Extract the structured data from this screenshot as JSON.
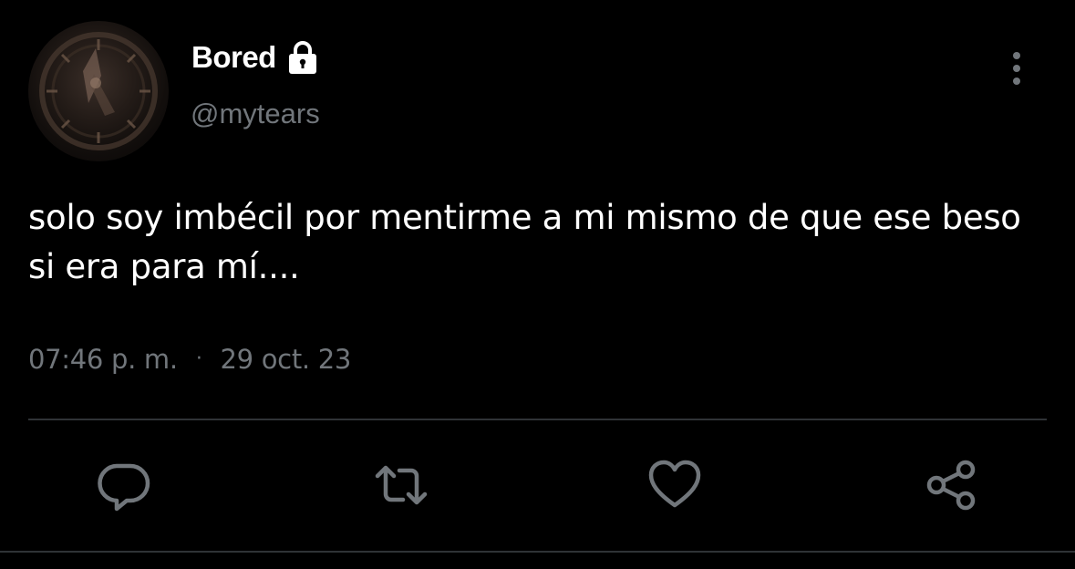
{
  "user": {
    "display_name": "Bored",
    "handle": "@mytears",
    "protected_icon": "lock-icon",
    "avatar": "clock-avatar"
  },
  "tweet": {
    "text": "solo soy imbécil por mentirme a mi mismo de que ese beso si era para mí....",
    "time": "07:46 p. m.",
    "separator": "·",
    "date": "29 oct. 23"
  },
  "actions": [
    {
      "name": "reply",
      "icon": "comment-icon"
    },
    {
      "name": "retweet",
      "icon": "retweet-icon"
    },
    {
      "name": "like",
      "icon": "heart-icon"
    },
    {
      "name": "share",
      "icon": "share-icon"
    }
  ],
  "menu": {
    "icon": "more-vertical-icon"
  },
  "colors": {
    "background": "#000000",
    "text": "#ffffff",
    "secondary_text": "#71767b",
    "icon": "#71767b",
    "divider": "#2f3336"
  }
}
